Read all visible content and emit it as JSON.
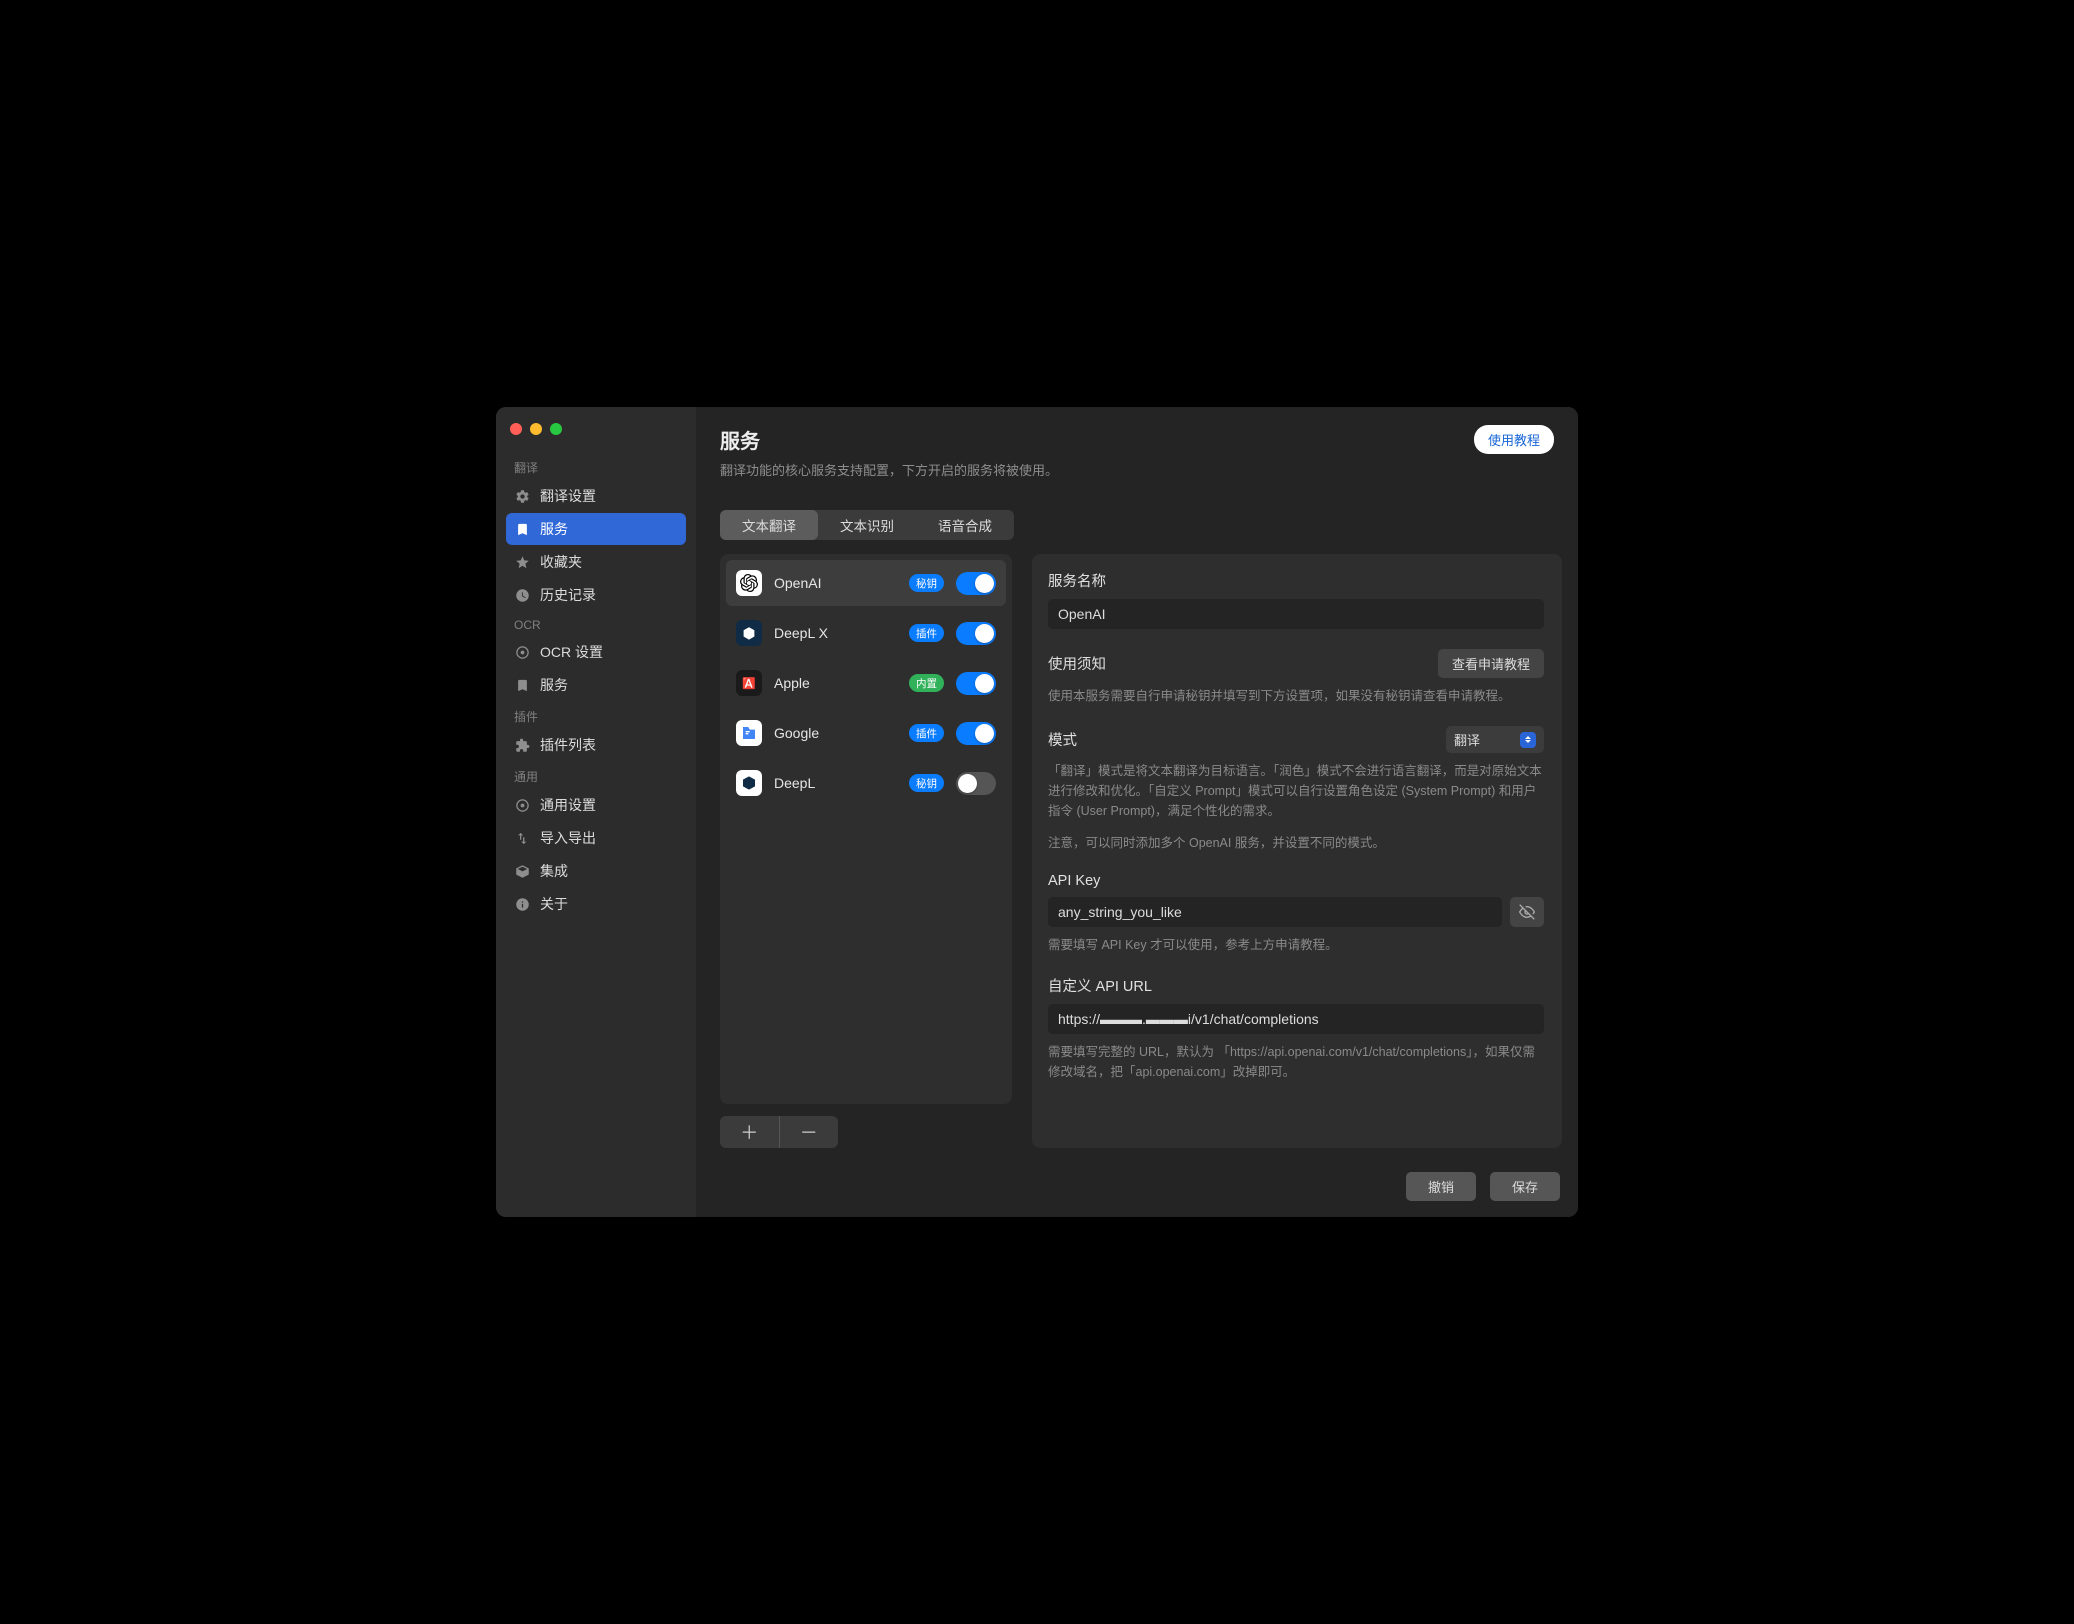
{
  "header": {
    "title": "服务",
    "subtitle": "翻译功能的核心服务支持配置，下方开启的服务将被使用。",
    "tutorial_btn": "使用教程"
  },
  "sidebar": {
    "sections": [
      {
        "label": "翻译",
        "items": [
          {
            "icon": "gear",
            "label": "翻译设置"
          },
          {
            "icon": "bookmark",
            "label": "服务",
            "active": true
          },
          {
            "icon": "star",
            "label": "收藏夹"
          },
          {
            "icon": "clock",
            "label": "历史记录"
          }
        ]
      },
      {
        "label": "OCR",
        "items": [
          {
            "icon": "target",
            "label": "OCR 设置"
          },
          {
            "icon": "bookmark",
            "label": "服务"
          }
        ]
      },
      {
        "label": "插件",
        "items": [
          {
            "icon": "puzzle",
            "label": "插件列表"
          }
        ]
      },
      {
        "label": "通用",
        "items": [
          {
            "icon": "target",
            "label": "通用设置"
          },
          {
            "icon": "arrows",
            "label": "导入导出"
          },
          {
            "icon": "cube",
            "label": "集成"
          },
          {
            "icon": "info",
            "label": "关于"
          }
        ]
      }
    ]
  },
  "tabs": [
    {
      "label": "文本翻译",
      "active": true
    },
    {
      "label": "文本识别"
    },
    {
      "label": "语音合成"
    }
  ],
  "services": [
    {
      "name": "OpenAI",
      "badge": "秘钥",
      "badge_type": "key",
      "on": true,
      "selected": true,
      "icon": "openai"
    },
    {
      "name": "DeepL X",
      "badge": "插件",
      "badge_type": "plugin",
      "on": true,
      "icon": "deeplx"
    },
    {
      "name": "Apple",
      "badge": "内置",
      "badge_type": "builtin",
      "on": true,
      "icon": "apple"
    },
    {
      "name": "Google",
      "badge": "插件",
      "badge_type": "plugin",
      "on": true,
      "icon": "google"
    },
    {
      "name": "DeepL",
      "badge": "秘钥",
      "badge_type": "key",
      "on": false,
      "icon": "deepl"
    }
  ],
  "detail": {
    "name_label": "服务名称",
    "name_value": "OpenAI",
    "notice_label": "使用须知",
    "notice_link": "查看申请教程",
    "notice_help": "使用本服务需要自行申请秘钥并填写到下方设置项，如果没有秘钥请查看申请教程。",
    "mode_label": "模式",
    "mode_value": "翻译",
    "mode_help1": "「翻译」模式是将文本翻译为目标语言。「润色」模式不会进行语言翻译，而是对原始文本进行修改和优化。「自定义 Prompt」模式可以自行设置角色设定 (System Prompt) 和用户指令 (User Prompt)，满足个性化的需求。",
    "mode_help2": "注意，可以同时添加多个 OpenAI 服务，并设置不同的模式。",
    "apikey_label": "API Key",
    "apikey_value": "any_string_you_like",
    "apikey_help": "需要填写 API Key 才可以使用，参考上方申请教程。",
    "apiurl_label": "自定义 API URL",
    "apiurl_value": "https://▬▬▬.▬▬▬i/v1/chat/completions",
    "apiurl_help": "需要填写完整的 URL，默认为 「https://api.openai.com/v1/chat/completions」，如果仅需修改域名，把「api.openai.com」改掉即可。"
  },
  "footer": {
    "cancel": "撤销",
    "save": "保存"
  }
}
